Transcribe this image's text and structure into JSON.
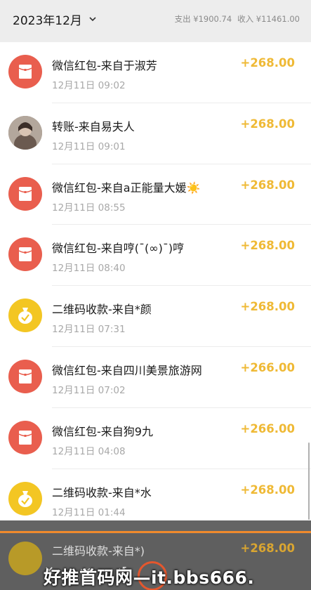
{
  "header": {
    "month": "2023年12月",
    "expense": "支出 ¥1900.74",
    "income": "收入 ¥11461.00"
  },
  "transactions": [
    {
      "title": "微信红包-来自于淑芳",
      "time": "12月11日 09:02",
      "amount": "+268.00",
      "icon": "red-packet-icon"
    },
    {
      "title": "转账-来自易夫人",
      "time": "12月11日 09:01",
      "amount": "+268.00",
      "icon": "avatar"
    },
    {
      "title": "微信红包-来自a正能量大媛☀️",
      "time": "12月11日 08:55",
      "amount": "+268.00",
      "icon": "red-packet-icon"
    },
    {
      "title": "微信红包-来自哼(¯(∞)¯)哼",
      "time": "12月11日 08:40",
      "amount": "+268.00",
      "icon": "red-packet-icon"
    },
    {
      "title": "二维码收款-来自*颜",
      "time": "12月11日 07:31",
      "amount": "+268.00",
      "icon": "money-bag-icon"
    },
    {
      "title": "微信红包-来自四川美景旅游网",
      "time": "12月11日 07:02",
      "amount": "+266.00",
      "icon": "red-packet-icon"
    },
    {
      "title": "微信红包-来自狗9九",
      "time": "12月11日 04:08",
      "amount": "+266.00",
      "icon": "red-packet-icon"
    },
    {
      "title": "二维码收款-来自*水",
      "time": "12月11日 01:44",
      "amount": "+268.00",
      "icon": "money-bag-icon"
    }
  ],
  "peek_row": {
    "title": "二维码收款-来自*)",
    "amount": "+268.00"
  },
  "watermark": "好推首码网—it.bbs666.",
  "colors": {
    "red_packet": "#e95e4e",
    "money_bag": "#f3c623",
    "amount": "#efb935"
  }
}
